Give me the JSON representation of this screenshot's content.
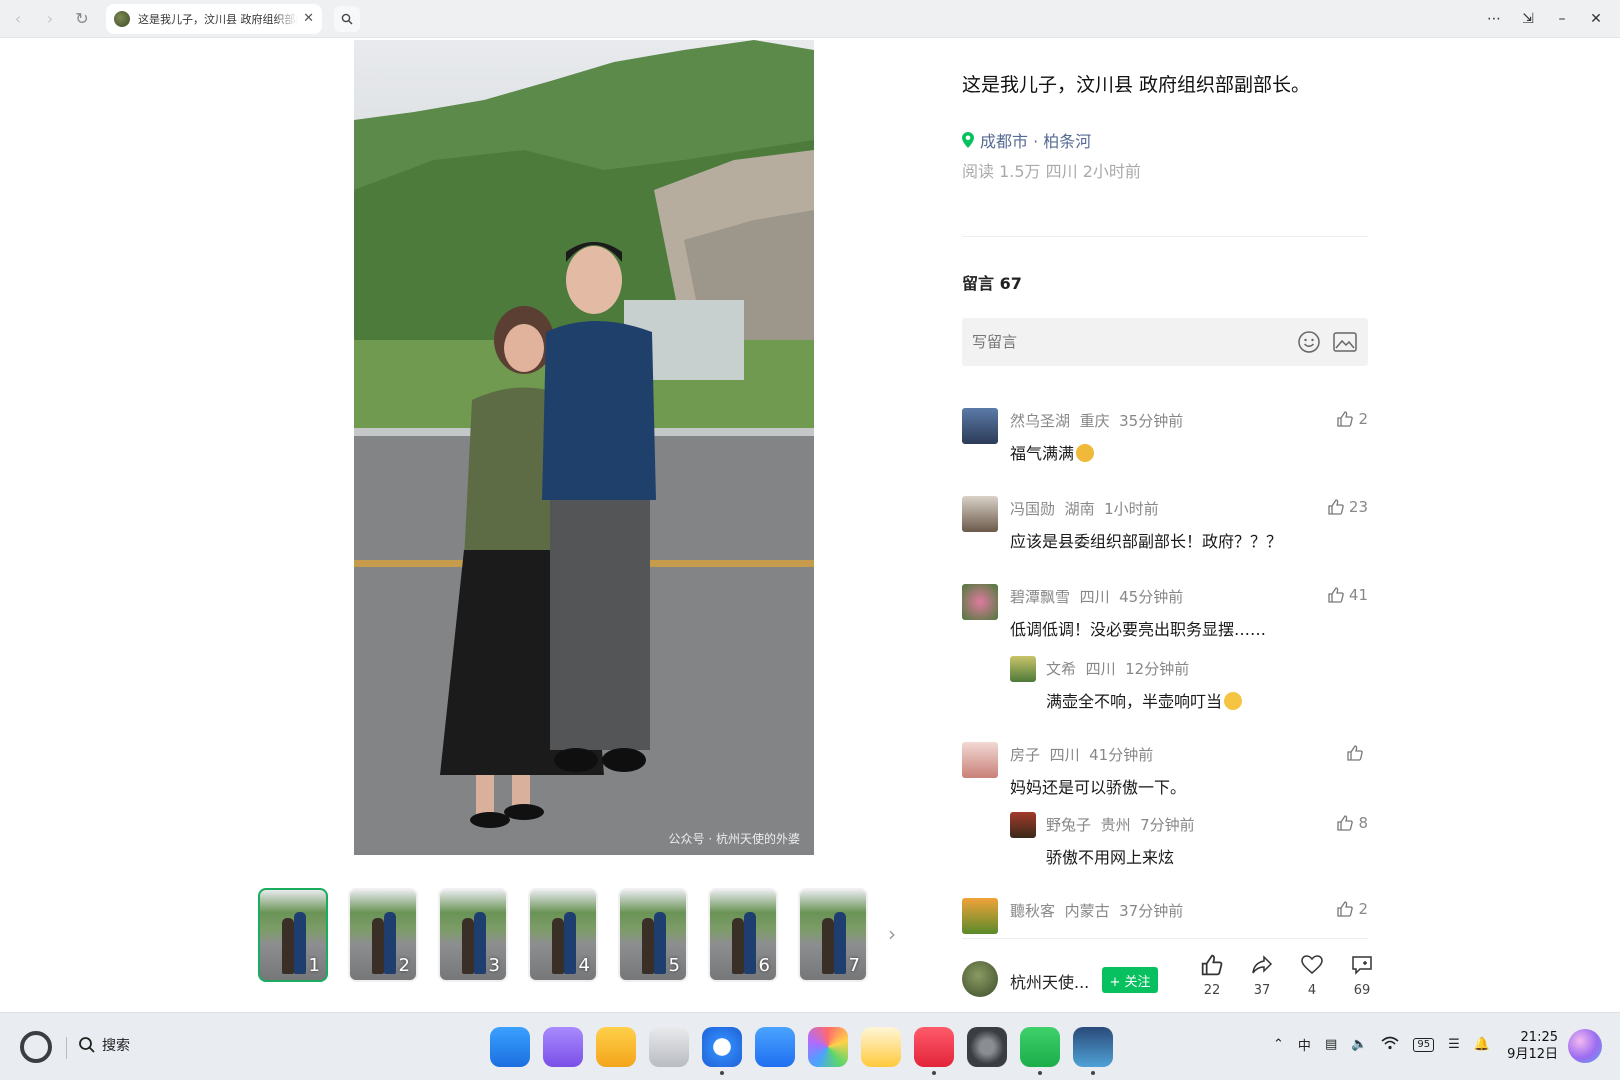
{
  "browser": {
    "tab_title": "这是我儿子，汶川县 政府组织部副部长。"
  },
  "photo": {
    "watermark": "公众号 · 杭州天使的外婆"
  },
  "thumbnails": [
    {
      "num": "1"
    },
    {
      "num": "2"
    },
    {
      "num": "3"
    },
    {
      "num": "4"
    },
    {
      "num": "5"
    },
    {
      "num": "6"
    },
    {
      "num": "7"
    }
  ],
  "post": {
    "title": "这是我儿子，汶川县 政府组织部副部长。",
    "location": "成都市 · 柏条河",
    "meta": "阅读 1.5万  四川  2小时前"
  },
  "comments_header": "留言 67",
  "comment_input": {
    "placeholder": "写留言"
  },
  "comments": [
    {
      "name": "然乌圣湖",
      "region": "重庆",
      "time": "35分钟前",
      "likes": "2",
      "text": "福气满满"
    },
    {
      "name": "冯国勋",
      "region": "湖南",
      "time": "1小时前",
      "likes": "23",
      "text": "应该是县委组织部副部长！政府？？？"
    },
    {
      "name": "碧潭飘雪",
      "region": "四川",
      "time": "45分钟前",
      "likes": "41",
      "text": "低调低调！没必要亮出职务显摆……"
    },
    {
      "name": "文希",
      "region": "四川",
      "time": "12分钟前",
      "likes": "",
      "text": "满壶全不响，半壶响叮当"
    },
    {
      "name": "房子",
      "region": "四川",
      "time": "41分钟前",
      "likes": "",
      "text": "妈妈还是可以骄傲一下。"
    },
    {
      "name": "野兔子",
      "region": "贵州",
      "time": "7分钟前",
      "likes": "8",
      "text": "骄傲不用网上来炫"
    },
    {
      "name": "聽秋客",
      "region": "内蒙古",
      "time": "37分钟前",
      "likes": "2",
      "text": ""
    }
  ],
  "author": {
    "name": "杭州天使...",
    "follow_label": "+ 关注"
  },
  "actions": {
    "like": "22",
    "share": "37",
    "favorite": "4",
    "comment": "69"
  },
  "taskbar": {
    "search_label": "搜索",
    "ime": "中",
    "battery": "95",
    "time": "21:25",
    "date": "9月12日"
  },
  "colors": {
    "accent": "#07c160",
    "link": "#576b95",
    "active_thumb": "#1aad5f"
  }
}
